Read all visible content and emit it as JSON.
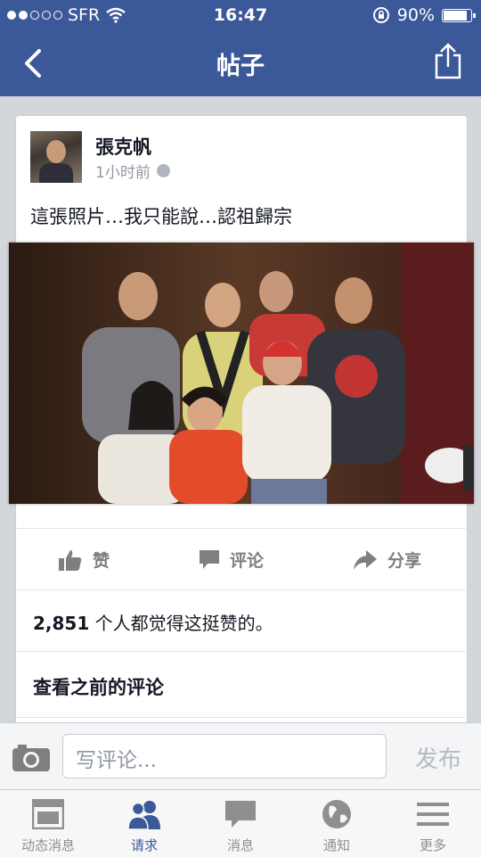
{
  "status_bar": {
    "carrier": "SFR",
    "signal_bars_filled": 2,
    "signal_bars_total": 5,
    "time": "16:47",
    "battery": "90%",
    "battery_level": 0.9
  },
  "nav": {
    "title": "帖子"
  },
  "post": {
    "author": "張克帆",
    "time": "1小时前",
    "text": "這張照片…我只能說…認祖歸宗"
  },
  "actions": {
    "like": "赞",
    "comment": "评论",
    "share": "分享"
  },
  "likes": {
    "count": "2,851",
    "text": " 个人都觉得这挺赞的。"
  },
  "view_previous_comments": "查看之前的评论",
  "composer": {
    "placeholder": "写评论...",
    "post_button": "发布"
  },
  "tabs": [
    {
      "label": "动态消息",
      "icon": "news-feed-icon",
      "active": false
    },
    {
      "label": "请求",
      "icon": "friend-requests-icon",
      "active": true
    },
    {
      "label": "消息",
      "icon": "messages-icon",
      "active": false
    },
    {
      "label": "通知",
      "icon": "globe-icon",
      "active": false
    },
    {
      "label": "更多",
      "icon": "menu-icon",
      "active": false
    }
  ],
  "colors": {
    "brand": "#3b5998",
    "muted": "#9197a3"
  }
}
